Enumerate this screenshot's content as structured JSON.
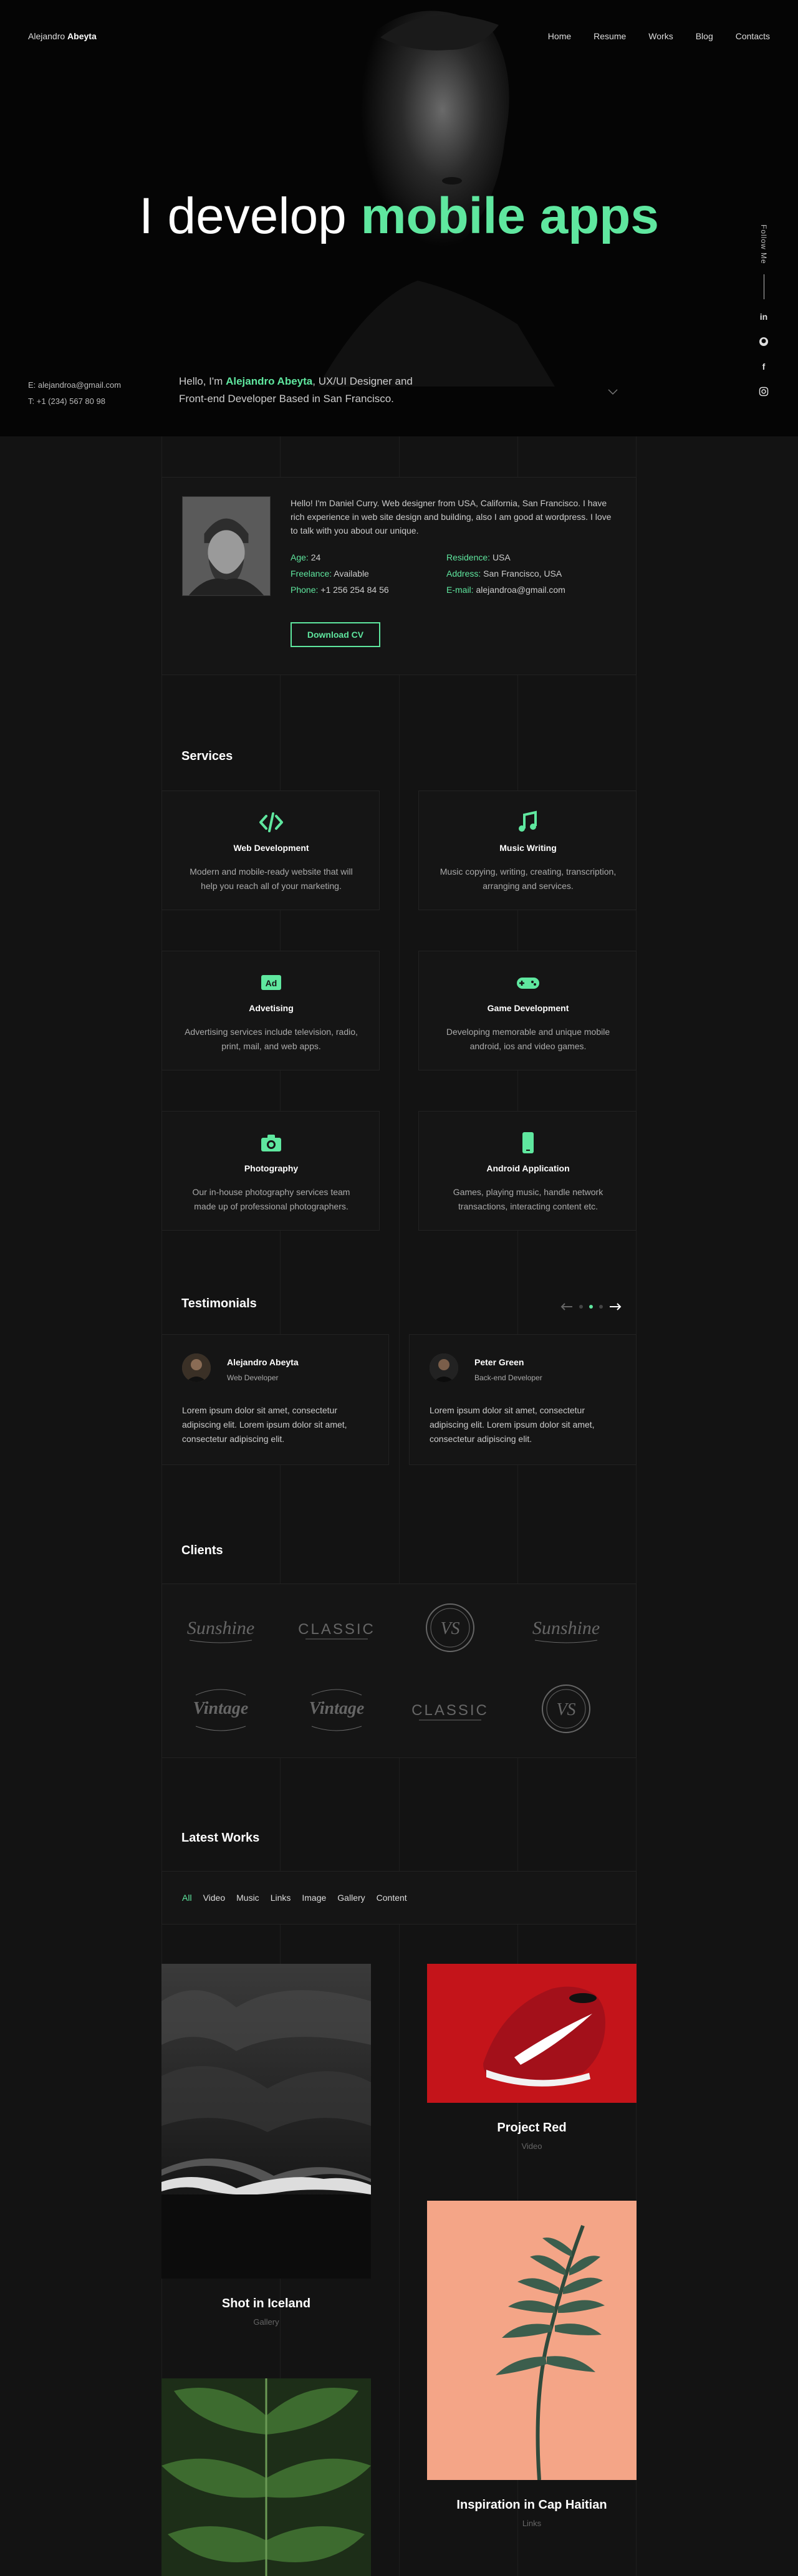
{
  "header": {
    "logo_first": "Alejandro",
    "logo_last": "Abeyta",
    "nav": [
      "Home",
      "Resume",
      "Works",
      "Blog",
      "Contacts"
    ]
  },
  "hero": {
    "title_plain": "I develop",
    "title_accent": "mobile apps",
    "email": "E: alejandroa@gmail.com",
    "phone": "T: +1 (234) 567 80 98",
    "intro_prefix": "Hello, I'm",
    "intro_name": "Alejandro Abeyta",
    "intro_suffix": ", UX/UI Designer and Front-end Developer Based in San Francisco.",
    "follow_label": "Follow Me",
    "social_icons": [
      "linkedin-icon",
      "github-icon",
      "facebook-icon",
      "instagram-icon"
    ]
  },
  "about": {
    "text": "Hello! I'm Daniel Curry. Web designer from USA, California, San Francisco. I have rich experience in web site design and building, also I am good at wordpress. I love to talk with you about our unique.",
    "info": [
      {
        "label": "Age:",
        "value": "24"
      },
      {
        "label": "Residence:",
        "value": "USA"
      },
      {
        "label": "Freelance:",
        "value": "Available"
      },
      {
        "label": "Address:",
        "value": "San Francisco, USA"
      },
      {
        "label": "Phone:",
        "value": "+1 256 254 84 56"
      },
      {
        "label": "E-mail:",
        "value": "alejandroa@gmail.com"
      }
    ],
    "download_label": "Download CV"
  },
  "services": {
    "title": "Services",
    "items": [
      {
        "title": "Web Development",
        "desc": "Modern and mobile-ready website that will help you reach all of your marketing.",
        "icon": "code-icon"
      },
      {
        "title": "Music Writing",
        "desc": "Music copying, writing, creating, transcription, arranging and services.",
        "icon": "music-icon"
      },
      {
        "title": "Advetising",
        "desc": "Advertising services include television, radio, print, mail, and web apps.",
        "icon": "ad-icon"
      },
      {
        "title": "Game Development",
        "desc": "Developing memorable and unique mobile android, ios and video games.",
        "icon": "gamepad-icon"
      },
      {
        "title": "Photography",
        "desc": "Our in-house photography services team made up of professional photographers.",
        "icon": "camera-icon"
      },
      {
        "title": "Android Application",
        "desc": "Games, playing music, handle network transactions, interacting content etc.",
        "icon": "android-icon"
      }
    ]
  },
  "testimonials": {
    "title": "Testimonials",
    "items": [
      {
        "name": "Alejandro Abeyta",
        "role": "Web Developer",
        "text": "Lorem ipsum dolor sit amet, consectetur adipiscing elit. Lorem ipsum dolor sit amet, consectetur adipiscing elit."
      },
      {
        "name": "Peter Green",
        "role": "Back-end Developer",
        "text": "Lorem ipsum dolor sit amet, consectetur adipiscing elit. Lorem ipsum dolor sit amet, consectetur adipiscing elit."
      }
    ]
  },
  "clients": {
    "title": "Clients",
    "logos": [
      {
        "name": "sunshine-logo",
        "text": "Sunshine"
      },
      {
        "name": "classic-logo",
        "text": "CLASSIC"
      },
      {
        "name": "vs-logo",
        "text": "VS"
      },
      {
        "name": "sunshine-logo",
        "text": "Sunshine"
      },
      {
        "name": "vintage-logo",
        "text": "Vintage"
      },
      {
        "name": "vintage-logo",
        "text": "Vintage"
      },
      {
        "name": "classic-logo",
        "text": "CLASSIC"
      },
      {
        "name": "vs-logo",
        "text": "VS"
      }
    ]
  },
  "works": {
    "title": "Latest Works",
    "filters": [
      "All",
      "Video",
      "Music",
      "Links",
      "Image",
      "Gallery",
      "Content"
    ],
    "active_filter": "All",
    "items": [
      {
        "title": "Shot in Iceland",
        "category": "Gallery"
      },
      {
        "title": "Project Red",
        "category": "Video"
      },
      {
        "title": "Inspiration in Cap Haitian",
        "category": "Links"
      }
    ]
  },
  "colors": {
    "accent": "#5fe79f",
    "background": "#131313"
  }
}
